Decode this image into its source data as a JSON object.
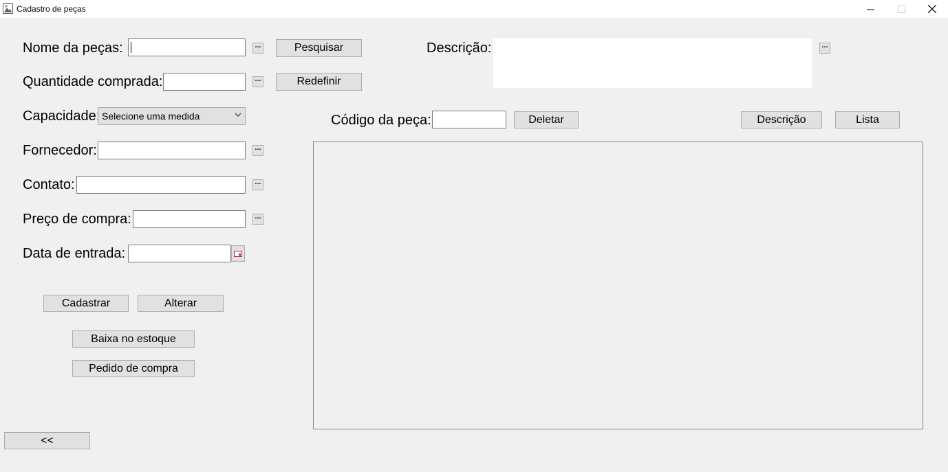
{
  "window": {
    "title": "Cadastro de peças",
    "minimize_glyph": "─",
    "maximize_glyph": "☐",
    "close_glyph": "✕"
  },
  "form": {
    "nome_label": "Nome da peças:",
    "nome_value": "",
    "quantidade_label": "Quantidade comprada:",
    "quantidade_value": "",
    "capacidade_label": "Capacidade:",
    "capacidade_selected": "Selecione uma medida",
    "fornecedor_label": "Fornecedor:",
    "fornecedor_value": "",
    "contato_label": "Contato:",
    "contato_value": "",
    "preco_label": "Preço de compra:",
    "preco_value": "",
    "data_label": "Data de entrada:",
    "data_value": "",
    "descricao_label": "Descrição:",
    "descricao_value": "",
    "codigo_label": "Código da peça:",
    "codigo_value": "",
    "ellipsis": "..."
  },
  "buttons": {
    "pesquisar": "Pesquisar",
    "redefinir": "Redefinir",
    "deletar": "Deletar",
    "descricao": "Descrição",
    "lista": "Lista",
    "cadastrar": "Cadastrar",
    "alterar": "Alterar",
    "baixa": "Baixa no estoque",
    "pedido": "Pedido de compra",
    "voltar": "<<"
  },
  "icons": {
    "app": "app-window-icon",
    "calendar": "calendar-icon",
    "chevron": "chevron-down-icon"
  }
}
